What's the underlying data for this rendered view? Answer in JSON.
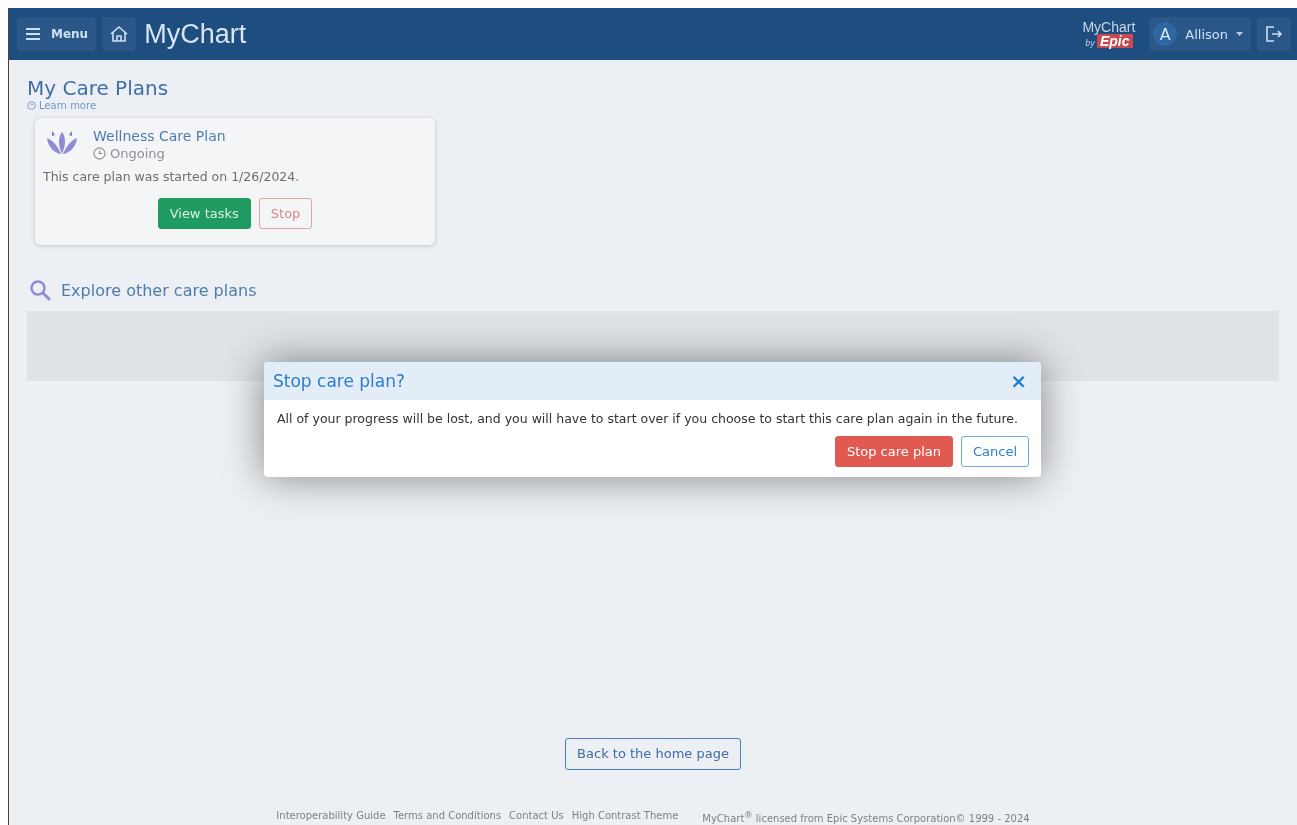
{
  "header": {
    "menu_label": "Menu",
    "logo": "MyChart",
    "epic_logo": {
      "top": "MyChart",
      "by": "by",
      "brand": "Epic"
    },
    "user": {
      "initial": "A",
      "name": "Allison"
    }
  },
  "page": {
    "title": "My Care Plans",
    "help_link": "Learn more"
  },
  "care_plans": [
    {
      "name": "Wellness Care Plan",
      "status": "Ongoing",
      "description": "This care plan was started on 1/26/2024.",
      "buttons": [
        {
          "label": "View tasks",
          "kind": "primary"
        },
        {
          "label": "Stop",
          "kind": "danger"
        }
      ]
    }
  ],
  "explore": {
    "heading": "Explore other care plans"
  },
  "dialog": {
    "title": "Stop care plan?",
    "close": "×",
    "message": "All of your progress will be lost, and you will have to start over if you choose to start this care plan again in the future.",
    "buttons": [
      {
        "label": "Stop care plan",
        "kind": "danger"
      },
      {
        "label": "Cancel",
        "kind": "secondary"
      }
    ]
  },
  "back_button": "Back to the home page",
  "footer": {
    "links": [
      "Interoperability Guide",
      "Terms and Conditions",
      "Contact Us",
      "High Contrast Theme"
    ],
    "copyright": "MyChart$^{®}$ licensed from Epic Systems Corporation© 1999 - 2024"
  }
}
